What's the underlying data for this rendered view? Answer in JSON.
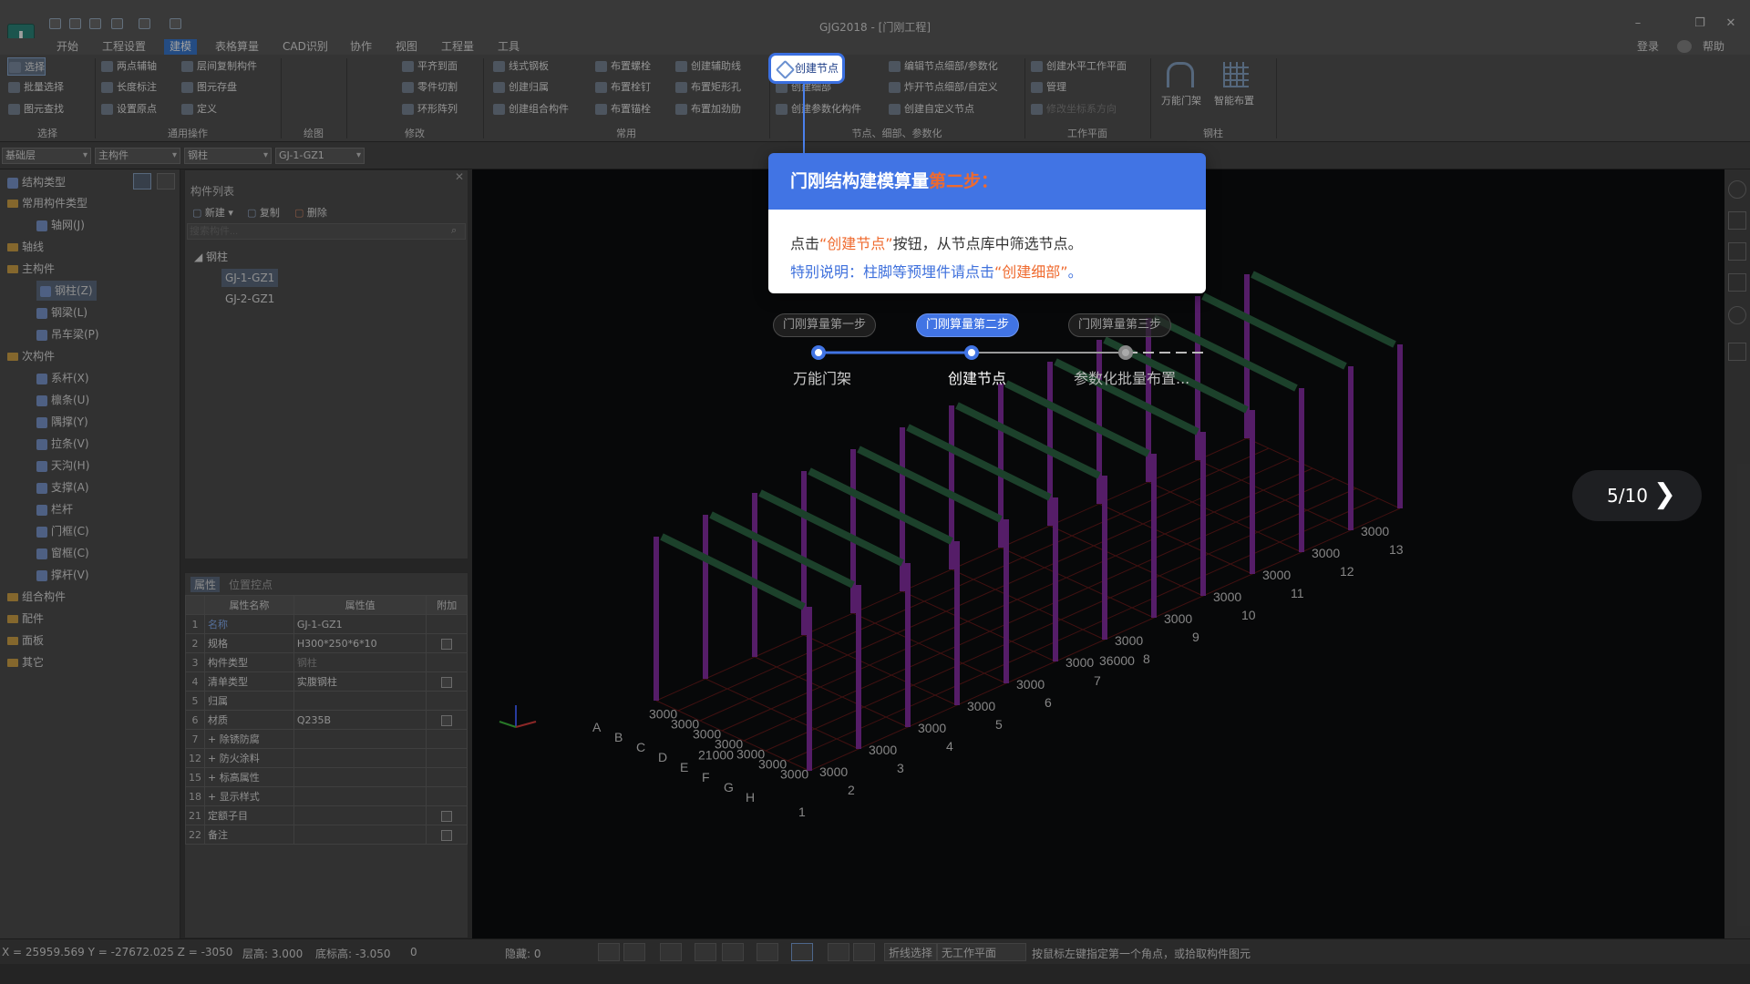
{
  "window": {
    "title": "GJG2018 - [门刚工程]",
    "logo": "I"
  },
  "menu": {
    "items": [
      "开始",
      "工程设置",
      "建模",
      "表格算量",
      "CAD识别",
      "协作",
      "视图",
      "工程量",
      "工具"
    ],
    "active": "建模",
    "right": {
      "login": "登录",
      "help": "帮助"
    }
  },
  "ribbon": {
    "select": {
      "select": "选择",
      "batch_select": "批量选择",
      "find": "图元查找",
      "label": "选择"
    },
    "general": {
      "two_point_aux": "两点辅轴",
      "length_mark": "长度标注",
      "set_origin": "设置原点",
      "floor_copy": "层间复制构件",
      "save_elem": "图元存盘",
      "define": "定义",
      "label": "通用操作"
    },
    "draw": {
      "label": "绘图"
    },
    "modify": {
      "align_top": "平齐到面",
      "part_cut": "零件切割",
      "ring_array": "环形阵列",
      "label": "修改"
    },
    "common": {
      "line_plate": "线式钢板",
      "create_attach": "创建归属",
      "create_combo": "创建组合构件",
      "bolt": "布置螺栓",
      "stud": "布置栓钉",
      "anchor": "布置锚栓",
      "aux_line": "创建辅助线",
      "rect_hole": "布置矩形孔",
      "rib": "布置加劲肋",
      "label": "常用"
    },
    "node": {
      "create_node": "创建节点",
      "create_detail": "创建细部",
      "param_comp": "创建参数化构件",
      "edit_node": "编辑节点细部/参数化",
      "explode_node": "炸开节点细部/自定义",
      "custom_node": "创建自定义节点",
      "label": "节点、细部、参数化"
    },
    "workplane": {
      "create_plane": "创建水平工作平面",
      "manage": "管理",
      "modify_coord": "修改坐标系方向",
      "label": "工作平面"
    },
    "steel": {
      "gantry": "万能门架",
      "smart": "智能布置",
      "label": "钢柱"
    }
  },
  "toolbar2": {
    "floor": "基础层",
    "category": "主构件",
    "type": "钢柱",
    "component": "GJ-1-GZ1"
  },
  "tree": {
    "header": "结构类型",
    "items": [
      {
        "label": "常用构件类型",
        "kind": "folder",
        "level": 0
      },
      {
        "label": "轴网(J)",
        "kind": "leaf",
        "level": 1
      },
      {
        "label": "轴线",
        "kind": "folder",
        "level": 0
      },
      {
        "label": "主构件",
        "kind": "folder",
        "level": 0
      },
      {
        "label": "钢柱(Z)",
        "kind": "leaf",
        "level": 1,
        "selected": true
      },
      {
        "label": "钢梁(L)",
        "kind": "leaf",
        "level": 1
      },
      {
        "label": "吊车梁(P)",
        "kind": "leaf",
        "level": 1
      },
      {
        "label": "次构件",
        "kind": "folder",
        "level": 0
      },
      {
        "label": "系杆(X)",
        "kind": "leaf",
        "level": 1
      },
      {
        "label": "檩条(U)",
        "kind": "leaf",
        "level": 1
      },
      {
        "label": "隅撑(Y)",
        "kind": "leaf",
        "level": 1
      },
      {
        "label": "拉条(V)",
        "kind": "leaf",
        "level": 1
      },
      {
        "label": "天沟(H)",
        "kind": "leaf",
        "level": 1
      },
      {
        "label": "支撑(A)",
        "kind": "leaf",
        "level": 1
      },
      {
        "label": "栏杆",
        "kind": "leaf",
        "level": 1
      },
      {
        "label": "门框(C)",
        "kind": "leaf",
        "level": 1
      },
      {
        "label": "窗框(C)",
        "kind": "leaf",
        "level": 1
      },
      {
        "label": "撑杆(V)",
        "kind": "leaf",
        "level": 1
      },
      {
        "label": "组合构件",
        "kind": "folder",
        "level": 0
      },
      {
        "label": "配件",
        "kind": "folder",
        "level": 0
      },
      {
        "label": "面板",
        "kind": "folder",
        "level": 0
      },
      {
        "label": "其它",
        "kind": "folder",
        "level": 0
      }
    ]
  },
  "component_list": {
    "title": "构件列表",
    "new": "新建",
    "copy": "复制",
    "delete": "删除",
    "search_placeholder": "搜索构件...",
    "group": "钢柱",
    "items": [
      "GJ-1-GZ1",
      "GJ-2-GZ1"
    ],
    "selected": "GJ-1-GZ1"
  },
  "properties": {
    "tabs": [
      "属性",
      "位置控点"
    ],
    "headers": [
      "属性名称",
      "属性值",
      "附加"
    ],
    "rows": [
      {
        "no": "1",
        "name": "名称",
        "value": "GJ-1-GZ1",
        "check": false
      },
      {
        "no": "2",
        "name": "规格",
        "value": "H300*250*6*10",
        "check": true
      },
      {
        "no": "3",
        "name": "构件类型",
        "value": "钢柱",
        "check": false
      },
      {
        "no": "4",
        "name": "清单类型",
        "value": "实腹钢柱",
        "check": true
      },
      {
        "no": "5",
        "name": "归属",
        "value": "",
        "check": false
      },
      {
        "no": "6",
        "name": "材质",
        "value": "Q235B",
        "check": true
      },
      {
        "no": "7",
        "name": "+ 除锈防腐",
        "value": "",
        "check": false
      },
      {
        "no": "12",
        "name": "+ 防火涂料",
        "value": "",
        "check": false
      },
      {
        "no": "15",
        "name": "+ 标高属性",
        "value": "",
        "check": false
      },
      {
        "no": "18",
        "name": "+ 显示样式",
        "value": "",
        "check": false
      },
      {
        "no": "21",
        "name": "定额子目",
        "value": "",
        "check": true
      },
      {
        "no": "22",
        "name": "备注",
        "value": "",
        "check": true
      }
    ]
  },
  "viewport": {
    "axes_left": [
      "H",
      "G",
      "F",
      "E",
      "D",
      "C",
      "B",
      "A"
    ],
    "axes_right": [
      "1",
      "2",
      "3",
      "4",
      "5",
      "6",
      "7",
      "8",
      "9",
      "10",
      "11",
      "12",
      "13"
    ],
    "spacing": "3000",
    "total_left": "21000",
    "total_right": "36000",
    "frames": 13,
    "colors": {
      "column": "#8a2fa8",
      "beam": "#2e6a46",
      "grid": "#6a1c1c"
    }
  },
  "tutorial": {
    "button": "创建节点",
    "title_prefix": "门刚结构建模算量",
    "title_accent": "第二步：",
    "line1_a": "点击",
    "line1_b": "“创建节点”",
    "line1_c": "按钮，从节点库中筛选节点。",
    "line2_a": "特别说明：柱脚等预埋件请点击",
    "line2_b": "“创建细部”",
    "line2_c": "。",
    "steps": [
      {
        "pill": "门刚算量第一步",
        "label": "万能门架"
      },
      {
        "pill": "门刚算量第二步",
        "label": "创建节点",
        "active": true
      },
      {
        "pill": "门刚算量第三步",
        "label": "参数化批量布置..."
      }
    ],
    "pager": "5/10"
  },
  "status": {
    "coords": "X = 25959.569 Y = -27672.025 Z = -3050",
    "floor_height": "层高: 3.000",
    "bottom_elev": "底标高: -3.050",
    "zero": "0",
    "hidden": "隐藏: 0",
    "polyline": "折线选择",
    "workplane": "无工作平面",
    "hint": "按鼠标左键指定第一个角点，或拾取构件图元"
  }
}
